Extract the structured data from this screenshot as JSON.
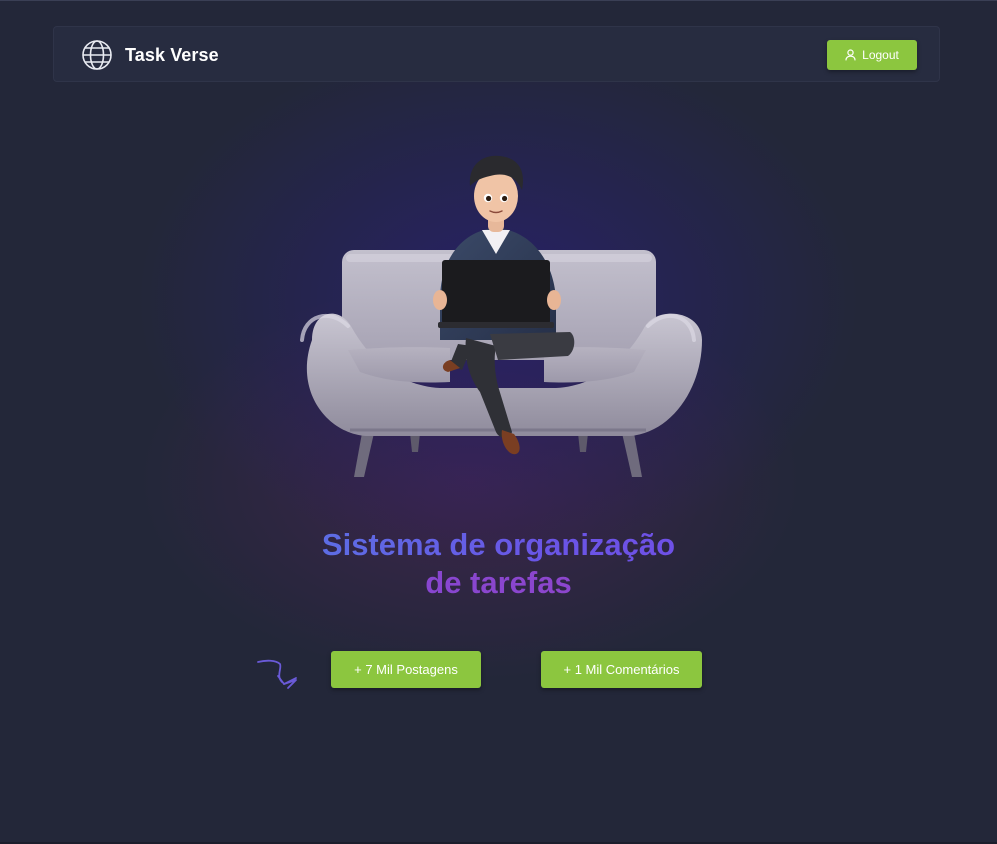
{
  "navbar": {
    "brand_title": "Task Verse",
    "brand_icon": "globe-icon",
    "logout_label": "Logout",
    "logout_icon": "user-icon"
  },
  "hero": {
    "title_line1": "Sistema de organização",
    "title_line2": "de tarefas",
    "illustration": "person-on-sofa-with-laptop"
  },
  "stats": {
    "posts_label": "+ 7 Mil Postagens",
    "comments_label": "+ 1 Mil Comentários",
    "doodle_icon": "arrow-doodle-icon"
  },
  "colors": {
    "background": "#232739",
    "navbar": "#272c40",
    "accent_green": "#8cc63f",
    "title_gradient_start": "#4a8fe0",
    "title_gradient_end": "#9a44c4"
  }
}
